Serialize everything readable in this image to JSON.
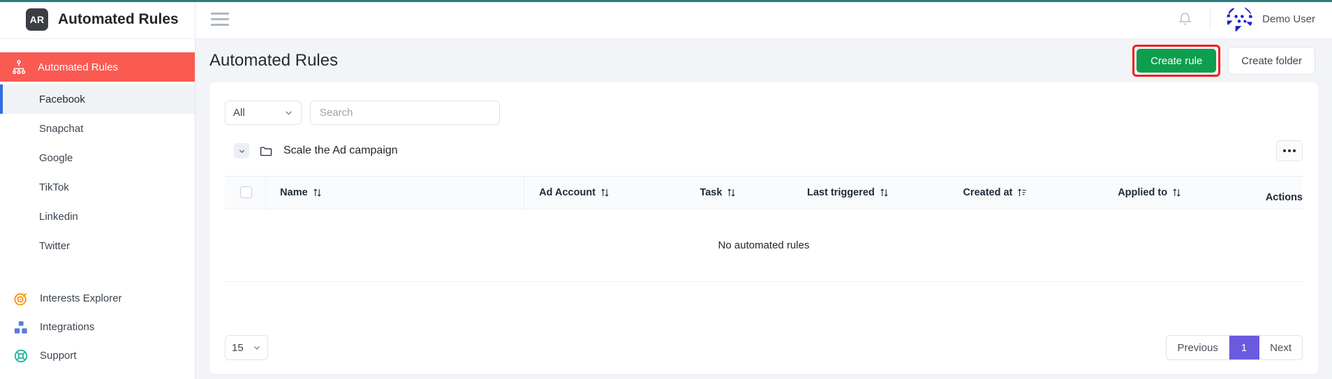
{
  "brand": {
    "logo_text": "AR",
    "title": "Automated Rules"
  },
  "sidebar": {
    "main_item": {
      "label": "Automated Rules",
      "icon": "sitemap-icon"
    },
    "sub_items": [
      {
        "label": "Facebook",
        "active": true
      },
      {
        "label": "Snapchat",
        "active": false
      },
      {
        "label": "Google",
        "active": false
      },
      {
        "label": "TikTok",
        "active": false
      },
      {
        "label": "Linkedin",
        "active": false
      },
      {
        "label": "Twitter",
        "active": false
      }
    ],
    "bottom_items": [
      {
        "label": "Interests Explorer",
        "icon": "target-icon",
        "color": "#f79009"
      },
      {
        "label": "Integrations",
        "icon": "blocks-icon",
        "color": "#5a7be0"
      },
      {
        "label": "Support",
        "icon": "lifebuoy-icon",
        "color": "#16b2a0"
      }
    ]
  },
  "topbar": {
    "menu_icon": "hamburger-icon",
    "bell_icon": "bell-icon",
    "user_name": "Demo User"
  },
  "page": {
    "title": "Automated Rules",
    "create_rule_label": "Create rule",
    "create_folder_label": "Create folder",
    "highlight_color": "#f51d1d",
    "create_rule_color": "#0d9e4e"
  },
  "filters": {
    "select_value": "All",
    "search_placeholder": "Search",
    "search_value": ""
  },
  "folder": {
    "name": "Scale the Ad campaign",
    "actions_label": "···"
  },
  "table": {
    "columns": [
      {
        "key": "check",
        "label": "",
        "sort": "none"
      },
      {
        "key": "name",
        "label": "Name",
        "sort": "both"
      },
      {
        "key": "account",
        "label": "Ad Account",
        "sort": "both"
      },
      {
        "key": "task",
        "label": "Task",
        "sort": "both"
      },
      {
        "key": "last",
        "label": "Last triggered",
        "sort": "both"
      },
      {
        "key": "created",
        "label": "Created at",
        "sort": "asc-lines"
      },
      {
        "key": "applied",
        "label": "Applied to",
        "sort": "both"
      },
      {
        "key": "actions",
        "label": "Actions",
        "sort": "none"
      }
    ],
    "rows": [],
    "empty_message": "No automated rules"
  },
  "footer": {
    "per_page": "15",
    "previous_label": "Previous",
    "current_page": "1",
    "next_label": "Next",
    "active_page_color": "#6a5ae0"
  }
}
